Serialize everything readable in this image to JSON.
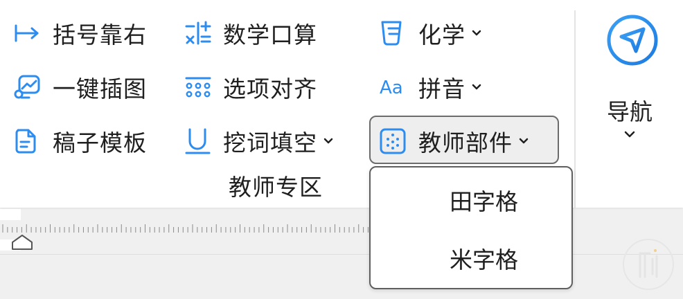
{
  "ribbon": {
    "col1": [
      {
        "label": "括号靠右",
        "icon": "arrow-right-bar-icon"
      },
      {
        "label": "一键插图",
        "icon": "image-edit-icon"
      },
      {
        "label": "稿子模板",
        "icon": "document-icon"
      }
    ],
    "col2": [
      {
        "label": "数学口算",
        "icon": "math-operators-icon"
      },
      {
        "label": "选项对齐",
        "icon": "options-grid-icon"
      },
      {
        "label": "挖词填空",
        "icon": "fill-blank-icon"
      }
    ],
    "col3": [
      {
        "label": "化学",
        "icon": "beaker-icon"
      },
      {
        "label": "拼音",
        "icon": "pinyin-aa-icon"
      },
      {
        "label": "教师部件",
        "icon": "dots-grid-icon"
      }
    ],
    "group_label": "教师专区",
    "nav_label": "导航"
  },
  "dropdown": {
    "items": [
      {
        "label": "田字格"
      },
      {
        "label": "米字格"
      }
    ]
  },
  "colors": {
    "accent": "#2d8cf0",
    "text": "#1f1f1f",
    "active_bg": "#eeeeee",
    "border": "#5f5f5f"
  }
}
